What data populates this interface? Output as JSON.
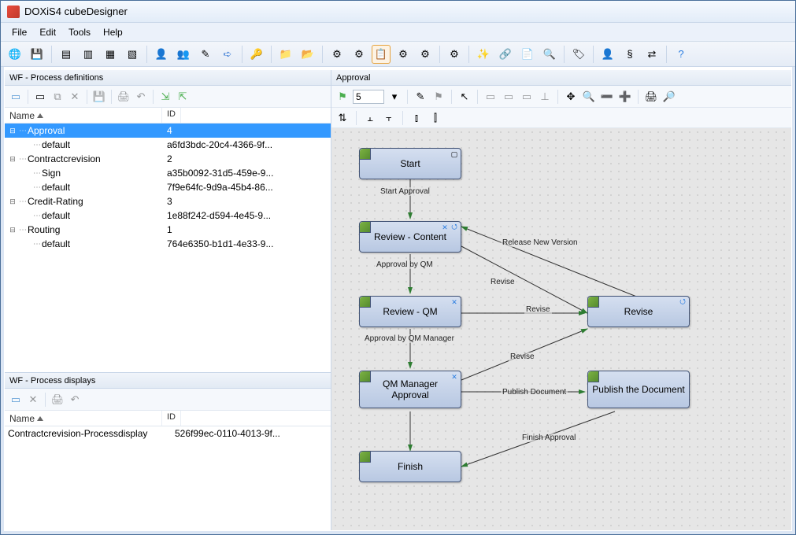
{
  "title": "DOXiS4 cubeDesigner",
  "menu": {
    "file": "File",
    "edit": "Edit",
    "tools": "Tools",
    "help": "Help"
  },
  "panels": {
    "processDefs": {
      "title": "WF - Process definitions",
      "colName": "Name",
      "colId": "ID"
    },
    "processDisplays": {
      "title": "WF - Process displays",
      "colName": "Name",
      "colId": "ID"
    }
  },
  "tree": [
    {
      "name": "Approval",
      "id": "4",
      "level": 0,
      "expanded": true,
      "selected": true
    },
    {
      "name": "default",
      "id": "a6fd3bdc-20c4-4366-9f...",
      "level": 1
    },
    {
      "name": "Contractcrevision",
      "id": "2",
      "level": 0,
      "expanded": true
    },
    {
      "name": "Sign",
      "id": "a35b0092-31d5-459e-9...",
      "level": 1
    },
    {
      "name": "default",
      "id": "7f9e64fc-9d9a-45b4-86...",
      "level": 1
    },
    {
      "name": "Credit-Rating",
      "id": "3",
      "level": 0,
      "expanded": true
    },
    {
      "name": "default",
      "id": "1e88f242-d594-4e45-9...",
      "level": 1
    },
    {
      "name": "Routing",
      "id": "1",
      "level": 0,
      "expanded": true
    },
    {
      "name": "default",
      "id": "764e6350-b1d1-4e33-9...",
      "level": 1
    }
  ],
  "displays": [
    {
      "name": "Contractcrevision-Processdisplay",
      "id": "526f99ec-0110-4013-9f..."
    }
  ],
  "canvas": {
    "title": "Approval",
    "version": "5",
    "nodes": {
      "start": "Start",
      "reviewContent": "Review - Content",
      "reviewQM": "Review - QM",
      "qmManager": "QM Manager Approval",
      "revise": "Revise",
      "publish": "Publish the Document",
      "finish": "Finish"
    },
    "edges": {
      "startApproval": "Start Approval",
      "approvalByQM": "Approval by QM",
      "approvalByQMManager": "Approval by QM Manager",
      "revise": "Revise",
      "releaseNewVersion": "Release New Version",
      "publishDocument": "Publish Document",
      "finishApproval": "Finish Approval"
    }
  }
}
